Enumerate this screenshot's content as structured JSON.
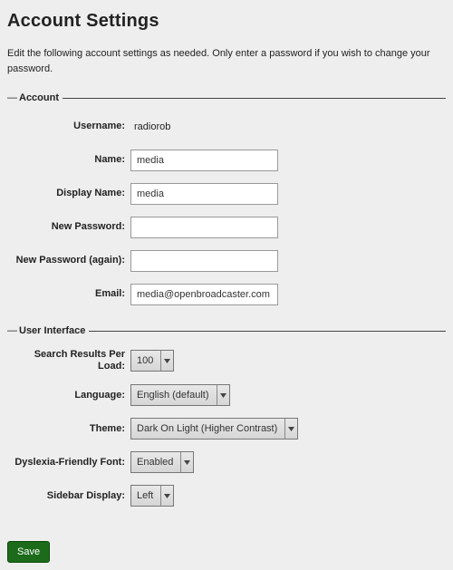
{
  "page": {
    "title": "Account Settings",
    "description": "Edit the following account settings as needed. Only enter a password if you wish to change your password."
  },
  "account": {
    "legend": "Account",
    "username_label": "Username:",
    "username_value": "radiorob",
    "name_label": "Name:",
    "name_value": "media",
    "display_name_label": "Display Name:",
    "display_name_value": "media",
    "new_password_label": "New Password:",
    "new_password_value": "",
    "new_password_again_label": "New Password (again):",
    "new_password_again_value": "",
    "email_label": "Email:",
    "email_value": "media@openbroadcaster.com"
  },
  "ui": {
    "legend": "User Interface",
    "results_per_load_label": "Search Results Per Load:",
    "results_per_load_value": "100",
    "language_label": "Language:",
    "language_value": "English (default)",
    "theme_label": "Theme:",
    "theme_value": "Dark On Light (Higher Contrast)",
    "dyslexia_font_label": "Dyslexia-Friendly Font:",
    "dyslexia_font_value": "Enabled",
    "sidebar_display_label": "Sidebar Display:",
    "sidebar_display_value": "Left"
  },
  "actions": {
    "save_label": "Save"
  }
}
